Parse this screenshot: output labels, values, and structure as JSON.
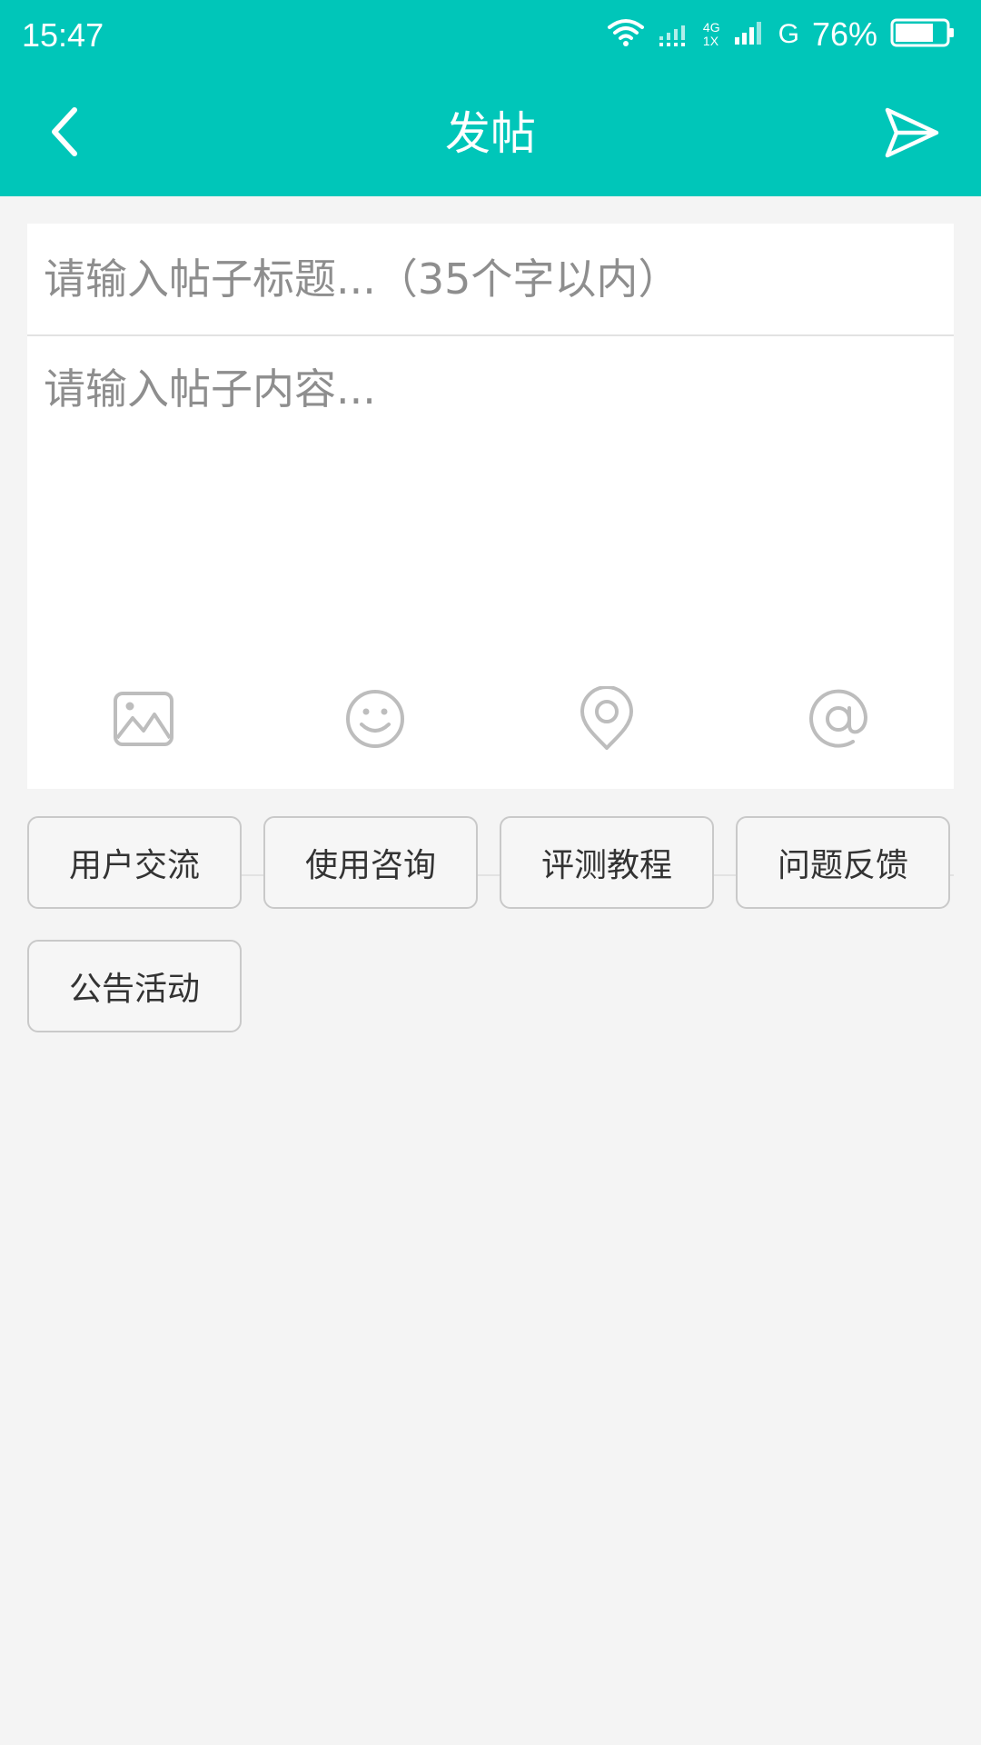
{
  "status_bar": {
    "time": "15:47",
    "network_4g_top": "4G",
    "network_4g_bottom": "1X",
    "network_g": "G",
    "battery_percent": "76%",
    "battery_level": 0.76
  },
  "header": {
    "title": "发帖",
    "back_icon": "chevron-left-icon",
    "send_icon": "send-icon"
  },
  "editor": {
    "title_placeholder": "请输入帖子标题...（35个字以内）",
    "title_value": "",
    "content_placeholder": "请输入帖子内容...",
    "content_value": ""
  },
  "toolbar": {
    "items": [
      "image-icon",
      "emoji-icon",
      "location-icon",
      "at-icon"
    ]
  },
  "categories": [
    "用户交流",
    "使用咨询",
    "评测教程",
    "问题反馈",
    "公告活动"
  ],
  "colors": {
    "accent": "#00c6b9",
    "background": "#f4f4f4",
    "icon_gray": "#bdbdbd"
  }
}
